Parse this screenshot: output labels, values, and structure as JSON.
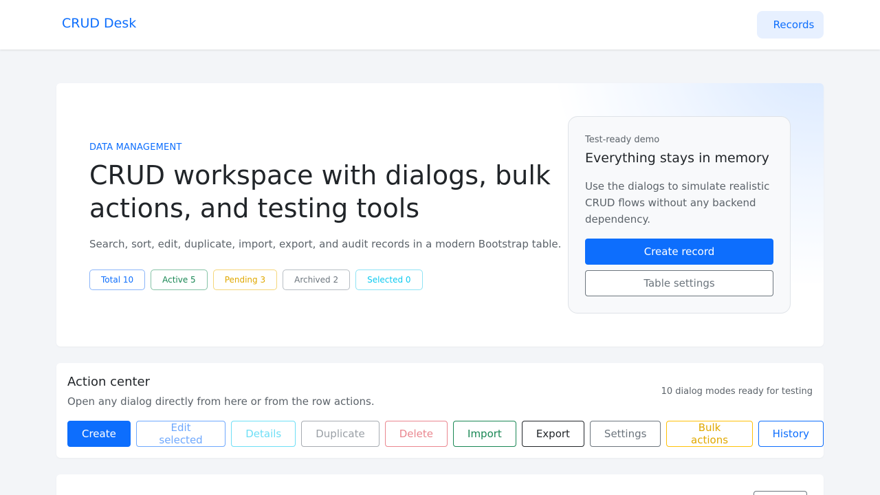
{
  "navbar": {
    "brand": "CRUD Desk",
    "records_link": "Records"
  },
  "hero": {
    "eyebrow": "DATA MANAGEMENT",
    "title": "CRUD workspace with dialogs, bulk actions, and testing tools",
    "subtitle": "Search, sort, edit, duplicate, import, export, and audit records in a modern Bootstrap table.",
    "badges": [
      {
        "label": "Total 10"
      },
      {
        "label": "Active 5"
      },
      {
        "label": "Pending 3"
      },
      {
        "label": "Archived 2"
      },
      {
        "label": "Selected 0"
      }
    ]
  },
  "demo_card": {
    "kicker": "Test-ready demo",
    "title": "Everything stays in memory",
    "text": "Use the dialogs to simulate realistic CRUD flows without any backend dependency.",
    "create_button": "Create record",
    "settings_button": "Table settings"
  },
  "action_center": {
    "title": "Action center",
    "subtitle": "Open any dialog directly from here or from the row actions.",
    "meta": "10 dialog modes ready for testing",
    "buttons": [
      {
        "label": "Create"
      },
      {
        "label": "Edit selected"
      },
      {
        "label": "Details"
      },
      {
        "label": "Duplicate"
      },
      {
        "label": "Delete"
      },
      {
        "label": "Import"
      },
      {
        "label": "Export"
      },
      {
        "label": "Settings"
      },
      {
        "label": "Bulk actions"
      },
      {
        "label": "History"
      }
    ]
  },
  "colors": {
    "primary": "#0d6efd",
    "success": "#198754",
    "warning": "#ffc107",
    "secondary": "#6c757d",
    "info": "#0dcaf0",
    "danger": "#dc3545"
  }
}
